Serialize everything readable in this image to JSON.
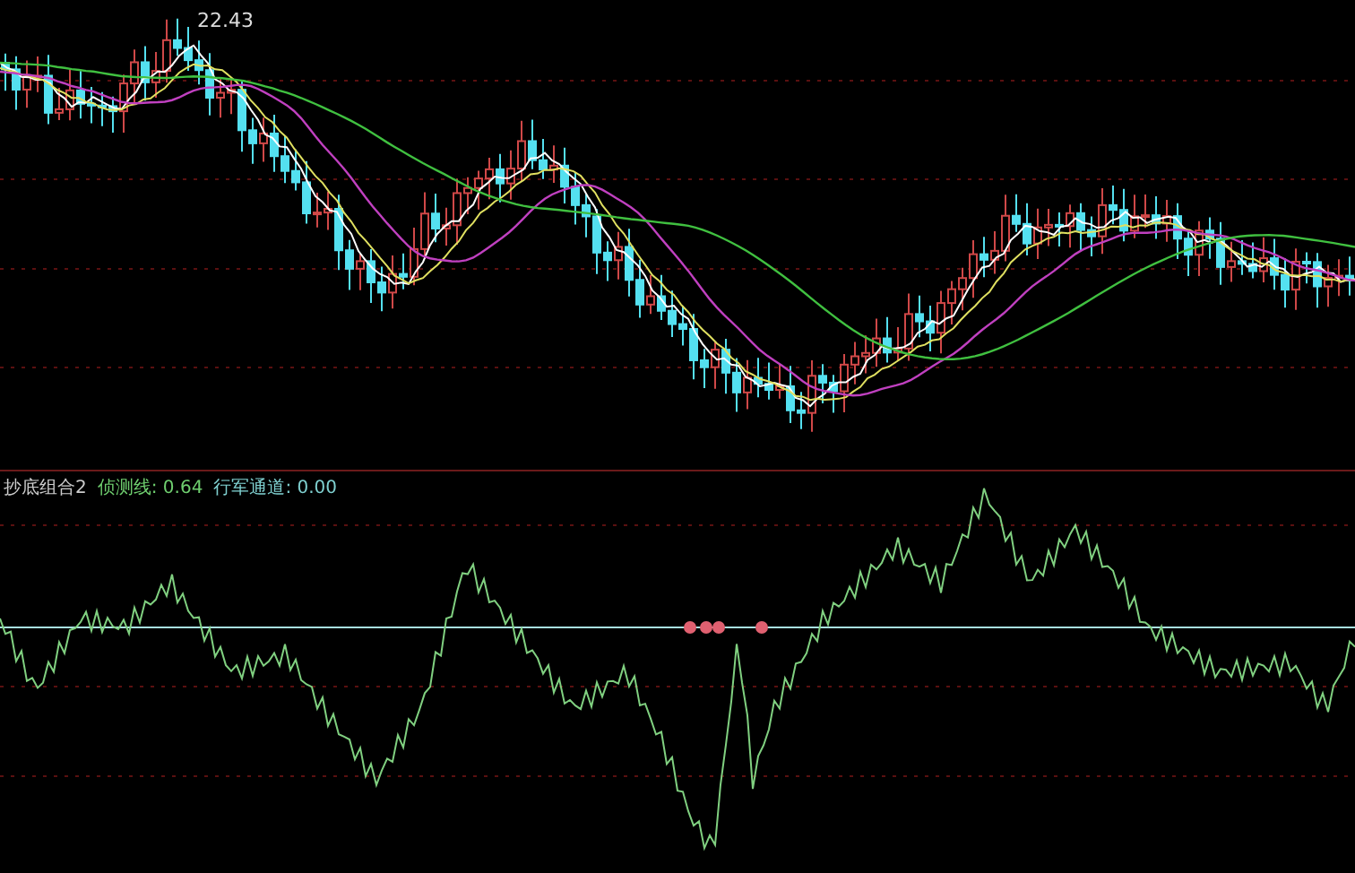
{
  "price_panel": {
    "high_label": "22.43"
  },
  "indicator_panel": {
    "title": "抄底组合2",
    "lines": [
      {
        "label": "侦测线: 0.64",
        "color": "#6fcf6f"
      },
      {
        "label": "行军通道: 0.00",
        "color": "#7fd0d0"
      }
    ]
  }
}
